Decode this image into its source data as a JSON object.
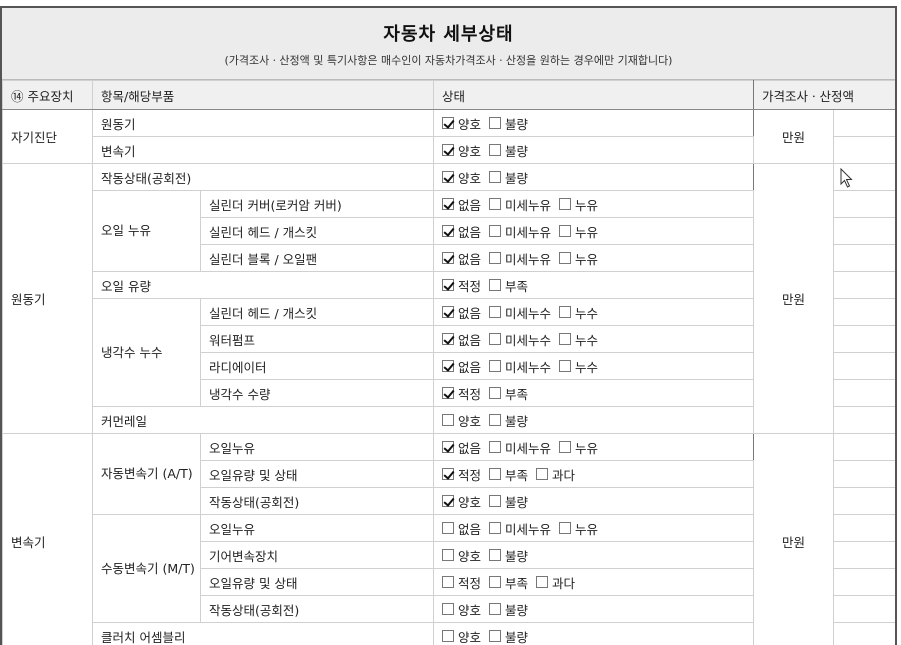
{
  "header": {
    "title": "자동차 세부상태",
    "subtitle": "(가격조사ㆍ산정액 및 특기사항은 매수인이 자동차가격조사ㆍ산정을 원하는 경우에만 기재합니다)"
  },
  "columns": {
    "main_device": "⑭ 주요장치",
    "item": "항목/해당부품",
    "status": "상태",
    "price": "가격조사ㆍ산정액"
  },
  "price_unit": "만원",
  "groups": [
    {
      "name": "자기진단",
      "rows": [
        {
          "item": "원동기",
          "options": [
            {
              "label": "양호",
              "checked": true
            },
            {
              "label": "불량",
              "checked": false
            }
          ]
        },
        {
          "item": "변속기",
          "options": [
            {
              "label": "양호",
              "checked": true
            },
            {
              "label": "불량",
              "checked": false
            }
          ]
        }
      ]
    },
    {
      "name": "원동기",
      "rows": [
        {
          "item": "작동상태(공회전)",
          "options": [
            {
              "label": "양호",
              "checked": true
            },
            {
              "label": "불량",
              "checked": false
            }
          ]
        },
        {
          "subgroup": "오일 누유",
          "item": "실린더 커버(로커암 커버)",
          "options": [
            {
              "label": "없음",
              "checked": true
            },
            {
              "label": "미세누유",
              "checked": false
            },
            {
              "label": "누유",
              "checked": false
            }
          ]
        },
        {
          "item": "실린더 헤드 / 개스킷",
          "options": [
            {
              "label": "없음",
              "checked": true
            },
            {
              "label": "미세누유",
              "checked": false
            },
            {
              "label": "누유",
              "checked": false
            }
          ]
        },
        {
          "item": "실린더 블록 / 오일팬",
          "options": [
            {
              "label": "없음",
              "checked": true
            },
            {
              "label": "미세누유",
              "checked": false
            },
            {
              "label": "누유",
              "checked": false
            }
          ]
        },
        {
          "item": "오일 유량",
          "options": [
            {
              "label": "적정",
              "checked": true
            },
            {
              "label": "부족",
              "checked": false
            }
          ]
        },
        {
          "subgroup": "냉각수 누수",
          "item": "실린더 헤드 / 개스킷",
          "options": [
            {
              "label": "없음",
              "checked": true
            },
            {
              "label": "미세누수",
              "checked": false
            },
            {
              "label": "누수",
              "checked": false
            }
          ]
        },
        {
          "item": "워터펌프",
          "options": [
            {
              "label": "없음",
              "checked": true
            },
            {
              "label": "미세누수",
              "checked": false
            },
            {
              "label": "누수",
              "checked": false
            }
          ]
        },
        {
          "item": "라디에이터",
          "options": [
            {
              "label": "없음",
              "checked": true
            },
            {
              "label": "미세누수",
              "checked": false
            },
            {
              "label": "누수",
              "checked": false
            }
          ]
        },
        {
          "item": "냉각수 수량",
          "options": [
            {
              "label": "적정",
              "checked": true
            },
            {
              "label": "부족",
              "checked": false
            }
          ]
        },
        {
          "item": "커먼레일",
          "options": [
            {
              "label": "양호",
              "checked": false
            },
            {
              "label": "불량",
              "checked": false
            }
          ]
        }
      ]
    },
    {
      "name": "변속기",
      "rows": [
        {
          "subgroup": "자동변속기 (A/T)",
          "item": "오일누유",
          "options": [
            {
              "label": "없음",
              "checked": true
            },
            {
              "label": "미세누유",
              "checked": false
            },
            {
              "label": "누유",
              "checked": false
            }
          ]
        },
        {
          "item": "오일유량 및 상태",
          "options": [
            {
              "label": "적정",
              "checked": true
            },
            {
              "label": "부족",
              "checked": false
            },
            {
              "label": "과다",
              "checked": false
            }
          ]
        },
        {
          "item": "작동상태(공회전)",
          "options": [
            {
              "label": "양호",
              "checked": true
            },
            {
              "label": "불량",
              "checked": false
            }
          ]
        },
        {
          "subgroup": "수동변속기 (M/T)",
          "item": "오일누유",
          "options": [
            {
              "label": "없음",
              "checked": false
            },
            {
              "label": "미세누유",
              "checked": false
            },
            {
              "label": "누유",
              "checked": false
            }
          ]
        },
        {
          "item": "기어변속장치",
          "options": [
            {
              "label": "양호",
              "checked": false
            },
            {
              "label": "불량",
              "checked": false
            }
          ]
        },
        {
          "item": "오일유량 및 상태",
          "options": [
            {
              "label": "적정",
              "checked": false
            },
            {
              "label": "부족",
              "checked": false
            },
            {
              "label": "과다",
              "checked": false
            }
          ]
        },
        {
          "item": "작동상태(공회전)",
          "options": [
            {
              "label": "양호",
              "checked": false
            },
            {
              "label": "불량",
              "checked": false
            }
          ]
        },
        {
          "item": "클러치 어셈블리",
          "options": [
            {
              "label": "양호",
              "checked": false
            },
            {
              "label": "불량",
              "checked": false
            }
          ]
        }
      ]
    }
  ]
}
